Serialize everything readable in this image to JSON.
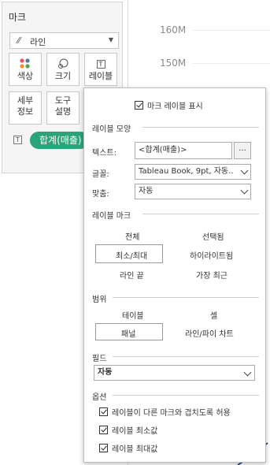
{
  "marks": {
    "title": "마크",
    "mark_type": "라인",
    "buttons": {
      "color": "색상",
      "size": "크기",
      "label": "레이블",
      "detail_1": "세부",
      "detail_2": "정보",
      "tooltip_1": "도구",
      "tooltip_2": "설명"
    },
    "pill": "합계(매출)",
    "pill_icon": "T",
    "label_icon": "T"
  },
  "axis": {
    "ticks": [
      "160M",
      "150M"
    ]
  },
  "popup": {
    "show_labels": "마크 레이블 표시",
    "appearance": {
      "section": "레이블 모양",
      "text_label": "텍스트:",
      "text_value": "<합계(매출)>",
      "more": "...",
      "font_label": "글꼴:",
      "font_value": "Tableau Book, 9pt, 자동..",
      "align_label": "맞춤:",
      "align_value": "자동"
    },
    "marks_section": {
      "section": "레이블 마크",
      "all": "전체",
      "selected": "선택됨",
      "minmax": "최소/최대",
      "highlighted": "하이라이트됨",
      "line_ends": "라인 끝",
      "most_recent": "가장 최근"
    },
    "scope": {
      "section": "범위",
      "table": "테이블",
      "cell": "셀",
      "pane": "패널",
      "line_pie": "라인/파이 차트"
    },
    "field": {
      "section": "필드",
      "value": "자동"
    },
    "options": {
      "section": "옵션",
      "overlap": "레이블이 다른 마크와 겹치도록 허용",
      "min": "레이블 최소값",
      "max": "레이블 최대값"
    }
  },
  "colors": {
    "accent": "#2aa478",
    "line": "#2f4f7f"
  }
}
